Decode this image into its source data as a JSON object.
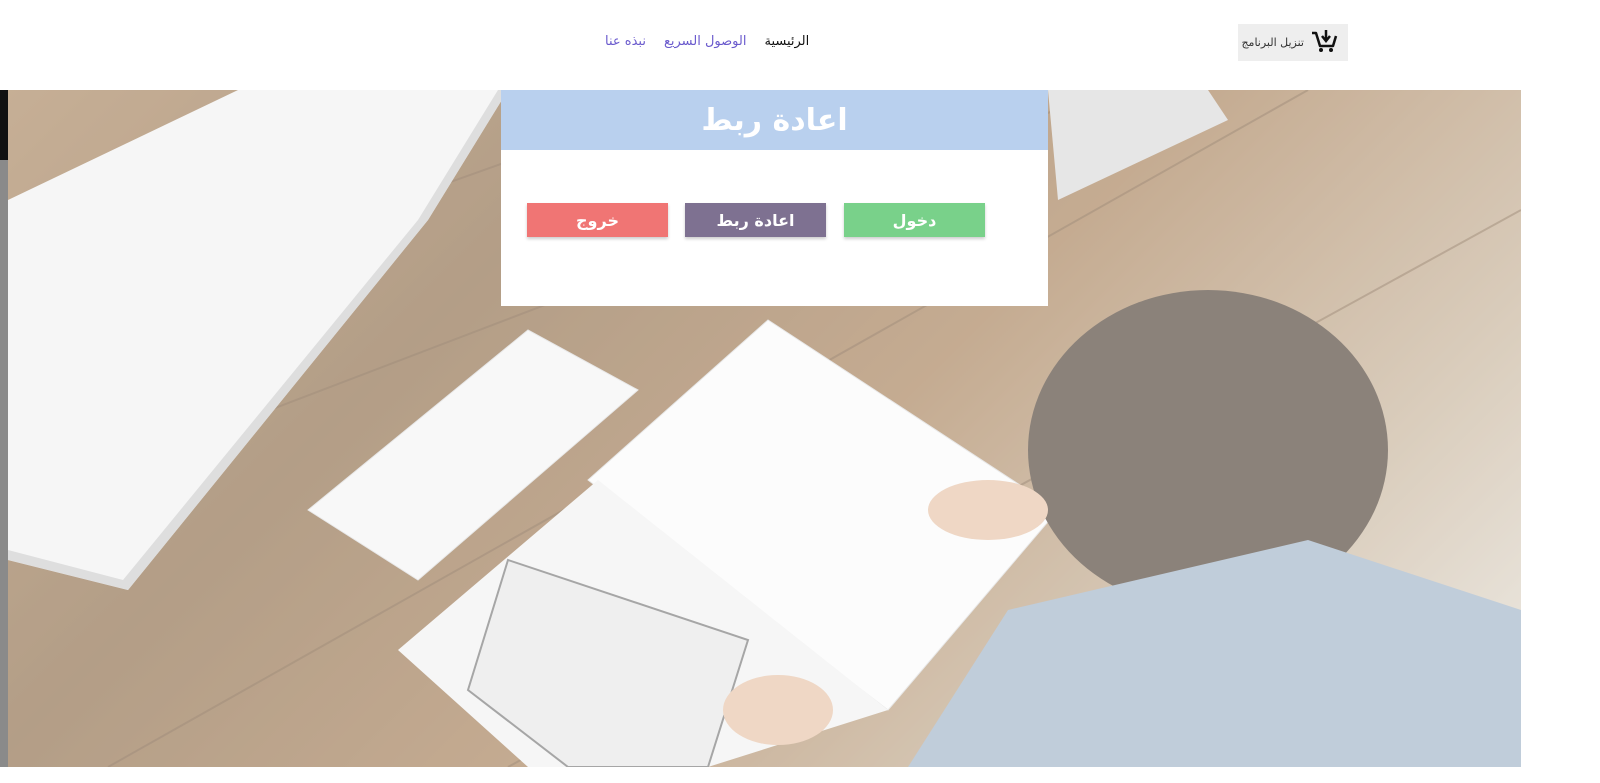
{
  "header": {
    "download_label": "تنزيل البرنامج",
    "nav": {
      "home": "الرئيسية",
      "quick_access": "الوصول السريع",
      "about": "نبذه عنا"
    }
  },
  "dialog": {
    "title": "اعادة ربط",
    "buttons": {
      "login": "دخول",
      "reconnect": "اعادة ربط",
      "exit": "خروج"
    }
  },
  "icons": {
    "download": "cart-download-icon"
  },
  "colors": {
    "title_bar": "#b9d0ee",
    "login": "#79d18a",
    "reconnect": "#7e7191",
    "exit": "#f07574",
    "nav_link": "#6a5acd"
  }
}
